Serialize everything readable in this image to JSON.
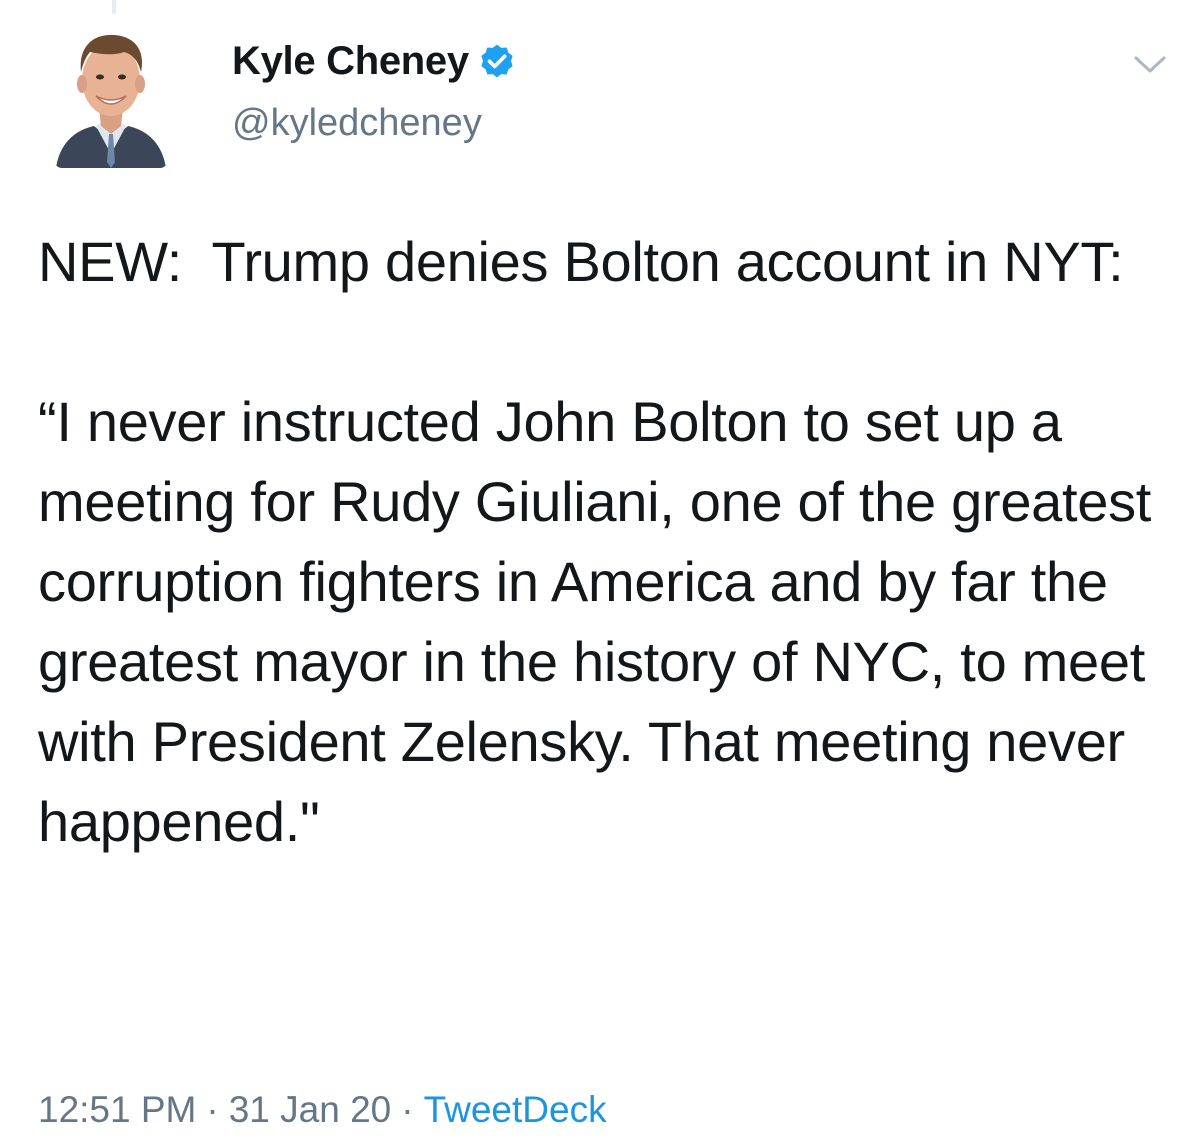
{
  "author": {
    "display_name": "Kyle Cheney",
    "handle": "@kyledcheney",
    "verified": true
  },
  "icons": {
    "avatar": "profile-photo",
    "verified": "verified-badge-icon",
    "menu": "chevron-down-icon"
  },
  "colors": {
    "text": "#14171a",
    "secondary": "#657786",
    "accent": "#1da1f2",
    "link": "#1b95e0"
  },
  "tweet": {
    "text": "NEW:  Trump denies Bolton account in NYT:\n\n“I never instructed John Bolton to set up a meeting for Rudy Giuliani, one of the greatest corruption fighters in America and by far the greatest mayor in the history of NYC, to meet with President Zelensky. That meeting never happened.\"",
    "time": "12:51 PM",
    "date": "31 Jan 20",
    "separator": "·",
    "source": "TweetDeck"
  }
}
